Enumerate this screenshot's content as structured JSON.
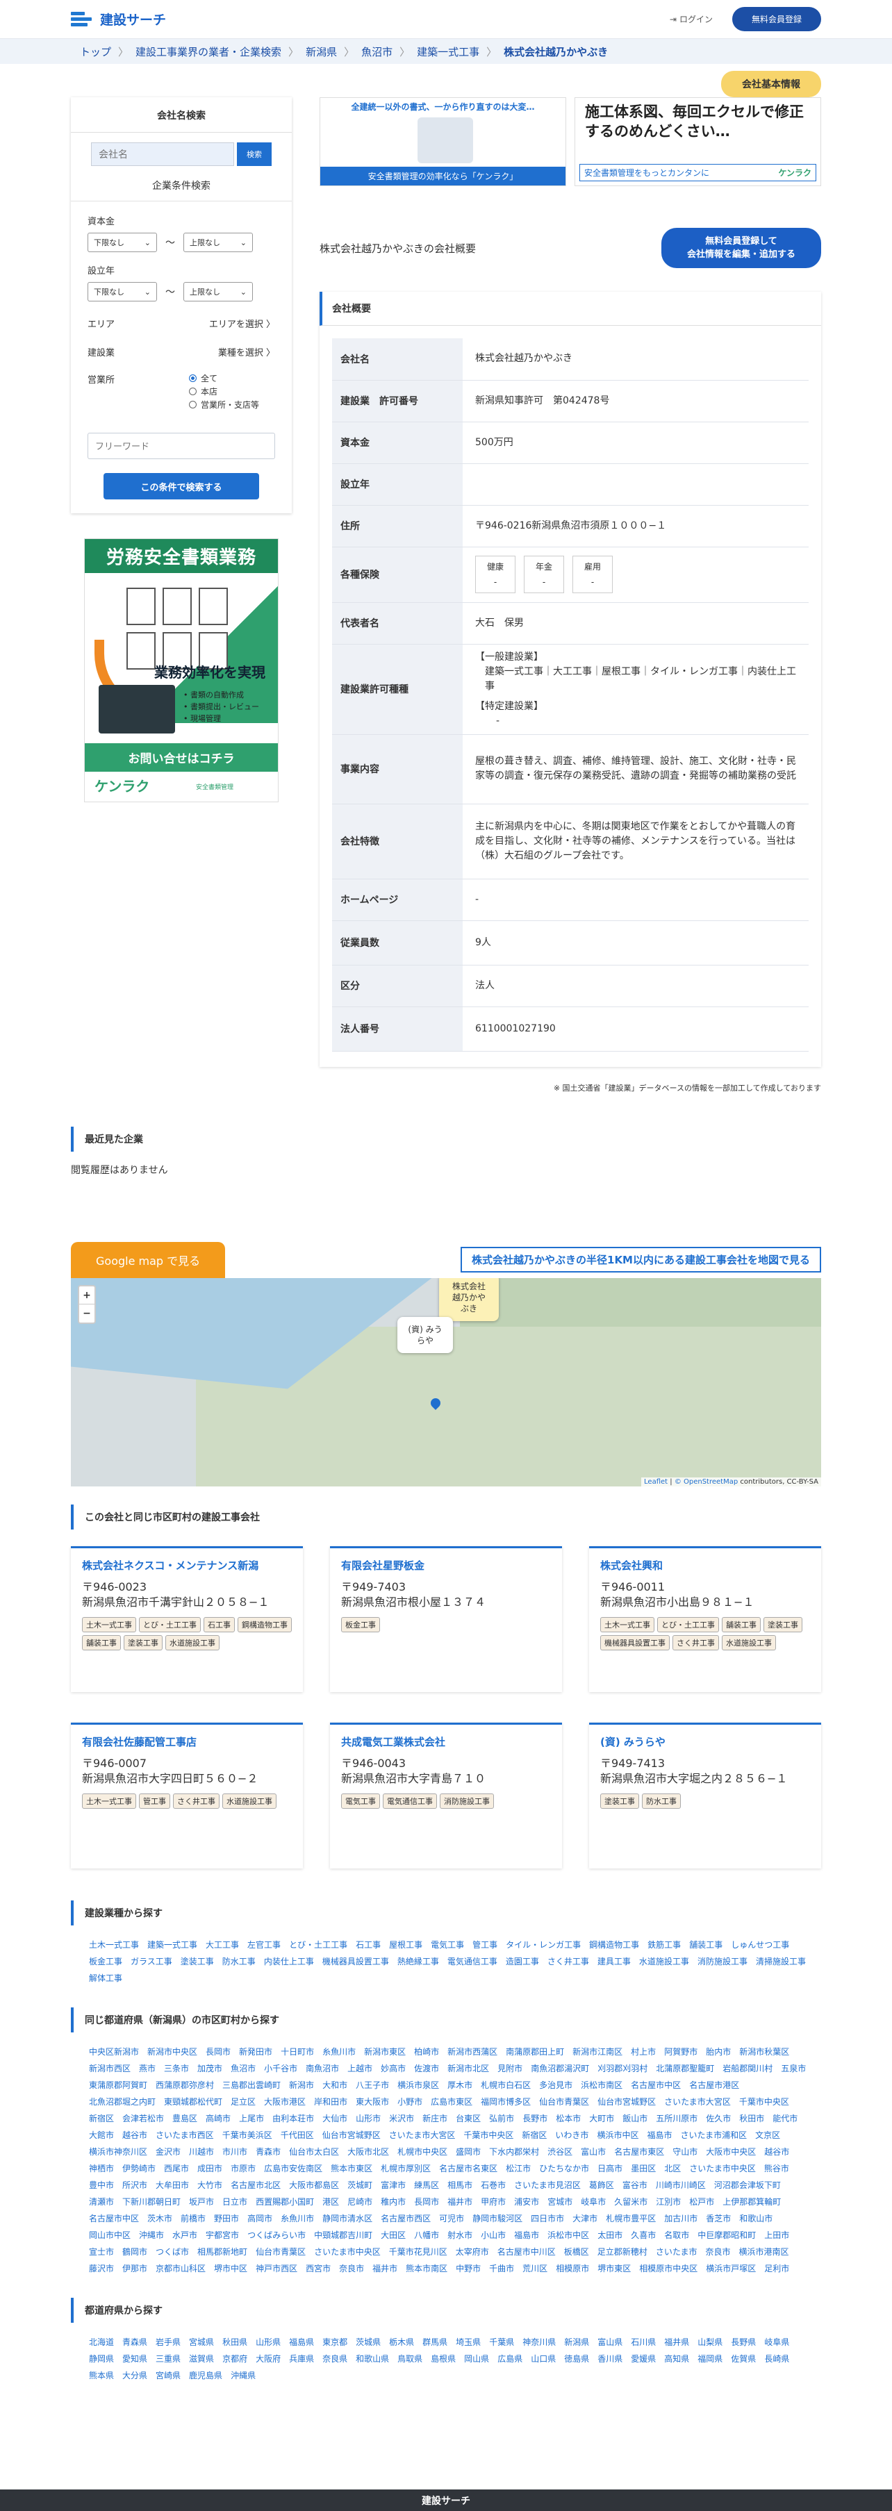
{
  "header": {
    "logo": "建設サーチ",
    "login": "ログイン",
    "register": "無料会員登録"
  },
  "breadcrumb": [
    "トップ",
    "建設工事業界の業者・企業検索",
    "新潟県",
    "魚沼市",
    "建築一式工事",
    "株式会社越乃かやぶき"
  ],
  "tag": "会社基本情報",
  "sidebar": {
    "title": "会社名検索",
    "search_placeholder": "会社名",
    "search_btn": "検索",
    "conditions": "企業条件検索",
    "capital": "資本金",
    "estab": "設立年",
    "lower": "下限なし",
    "upper": "上限なし",
    "tilde": "〜",
    "area": "エリア",
    "area_v": "エリアを選択",
    "industry": "建設業",
    "industry_v": "業種を選択",
    "office": "営業所",
    "office_opts": [
      "全て",
      "本店",
      "営業所・支店等"
    ],
    "free_placeholder": "フリーワード",
    "submit": "この条件で検索する"
  },
  "ad": {
    "title": "労務安全書類業務",
    "eff": "業務効率化を実現",
    "points": [
      "書類の自動作成",
      "書類提出・レビュー",
      "現場管理"
    ],
    "cta": "お問い合せはコチラ",
    "brand": "ケンラク",
    "small": "安全書類管理"
  },
  "banner1": {
    "text": "全建統一以外の書式、一から作り直すのは大変…",
    "caption": "安全書類管理の効率化なら「ケンラク」"
  },
  "banner2": {
    "text": "施工体系図、毎回エクセルで修正するのめんどくさい…",
    "caption": "安全書類管理をもっとカンタンに",
    "brand": "ケンラク"
  },
  "company_heading": "株式会社越乃かやぶきの会社概要",
  "free_btn": [
    "無料会員登録して",
    "会社情報を編集・追加する"
  ],
  "overview": "会社概要",
  "info": {
    "rows": [
      {
        "k": "会社名",
        "v": "株式会社越乃かやぶき"
      },
      {
        "k": "建設業　許可番号",
        "v": "新潟県知事許可　第042478号"
      },
      {
        "k": "資本金",
        "v": "500万円"
      },
      {
        "k": "設立年",
        "v": ""
      },
      {
        "k": "住所",
        "v": "〒946-0216新潟県魚沼市須原１０００−１"
      },
      {
        "k": "各種保険",
        "v": ""
      },
      {
        "k": "代表者名",
        "v": "大石　保男"
      },
      {
        "k": "建設業許可種種",
        "v": ""
      },
      {
        "k": "事業内容",
        "v": "屋根の葺き替え、調査、補修、維持管理、設計、施工、文化財・社寺・民家等の調査・復元保存の業務受託、遺跡の調査・発掘等の補助業務の受託"
      },
      {
        "k": "会社特徴",
        "v": "主に新潟県内を中心に、冬期は関東地区で作業をとおしてかや葺職人の育成を目指し、文化財・社寺等の補修、メンテナンスを行っている。当社は（株）大石組のグループ会社です。"
      },
      {
        "k": "ホームページ",
        "v": "-"
      },
      {
        "k": "従業員数",
        "v": "9人"
      },
      {
        "k": "区分",
        "v": "法人"
      },
      {
        "k": "法人番号",
        "v": "6110001027190"
      }
    ],
    "insurance": [
      {
        "n": "健康",
        "v": "-"
      },
      {
        "n": "年金",
        "v": "-"
      },
      {
        "n": "雇用",
        "v": "-"
      }
    ],
    "permit_general": "【一般建設業】",
    "permit_general_v": "建築一式工事｜大工工事｜屋根工事｜タイル・レンガ工事｜内装仕上工事",
    "permit_special": "【特定建設業】",
    "permit_special_v": "-"
  },
  "note": "※ 国土交通省「建設業」データベースの情報を一部加工して作成しております",
  "recent": {
    "title": "最近見た企業",
    "empty": "閲覧履歴はありません"
  },
  "map": {
    "gbtn": "Google map で見る",
    "radius": "株式会社越乃かやぶきの半径1KM以内にある建設工事会社を地図で見る",
    "pop1": "(資) みうらや",
    "pop2": "株式会社越乃かやぶき",
    "attr_a": "Leaflet",
    "attr_b": "© OpenStreetMap",
    "attr_c": "contributors, CC-BY-SA",
    "plus": "+",
    "minus": "−"
  },
  "same_city": "この会社と同じ市区町村の建設工事会社",
  "cards": [
    {
      "name": "株式会社ネクスコ・メンテナンス新潟",
      "zip": "〒946-0023",
      "addr": "新潟県魚沼市千溝宇針山２０５８−１",
      "tags": [
        "土木一式工事",
        "とび・土工工事",
        "石工事",
        "鋼構造物工事",
        "舗装工事",
        "塗装工事",
        "水道施設工事"
      ]
    },
    {
      "name": "有限会社星野板金",
      "zip": "〒949-7403",
      "addr": "新潟県魚沼市根小屋１３７４",
      "tags": [
        "板金工事"
      ]
    },
    {
      "name": "株式会社興和",
      "zip": "〒946-0011",
      "addr": "新潟県魚沼市小出島９８１−１",
      "tags": [
        "土木一式工事",
        "とび・土工工事",
        "舗装工事",
        "塗装工事",
        "機械器具設置工事",
        "さく井工事",
        "水道施設工事"
      ]
    },
    {
      "name": "有限会社佐藤配管工事店",
      "zip": "〒946-0007",
      "addr": "新潟県魚沼市大字四日町５６０−２",
      "tags": [
        "土木一式工事",
        "管工事",
        "さく井工事",
        "水道施設工事"
      ]
    },
    {
      "name": "共成電気工業株式会社",
      "zip": "〒946-0043",
      "addr": "新潟県魚沼市大字青島７１０",
      "tags": [
        "電気工事",
        "電気通信工事",
        "消防施設工事"
      ]
    },
    {
      "name": "(資) みうらや",
      "zip": "〒949-7413",
      "addr": "新潟県魚沼市大字堀之内２８５６−１",
      "tags": [
        "塗装工事",
        "防水工事"
      ]
    }
  ],
  "by_type": {
    "title": "建設業種から探す",
    "items": [
      "土木一式工事",
      "建築一式工事",
      "大工工事",
      "左官工事",
      "とび・土工工事",
      "石工事",
      "屋根工事",
      "電気工事",
      "管工事",
      "タイル・レンガ工事",
      "鋼構造物工事",
      "鉄筋工事",
      "舗装工事",
      "しゅんせつ工事",
      "板金工事",
      "ガラス工事",
      "塗装工事",
      "防水工事",
      "内装仕上工事",
      "機械器具設置工事",
      "熱絶縁工事",
      "電気通信工事",
      "造園工事",
      "さく井工事",
      "建具工事",
      "水道施設工事",
      "消防施設工事",
      "清掃施設工事",
      "解体工事"
    ]
  },
  "by_city": {
    "title": "同じ都道府県（新潟県）の市区町村から探す",
    "items": [
      "中央区新潟市",
      "新潟市中央区",
      "長岡市",
      "新発田市",
      "十日町市",
      "糸魚川市",
      "新潟市東区",
      "柏崎市",
      "新潟市西蒲区",
      "南蒲原郡田上町",
      "新潟市江南区",
      "村上市",
      "阿賀野市",
      "胎内市",
      "新潟市秋葉区",
      "新潟市西区",
      "燕市",
      "三条市",
      "加茂市",
      "魚沼市",
      "小千谷市",
      "南魚沼市",
      "上越市",
      "妙高市",
      "佐渡市",
      "新潟市北区",
      "見附市",
      "南魚沼郡湯沢町",
      "刈羽郡刈羽村",
      "北蒲原郡聖籠町",
      "岩船郡関川村",
      "五泉市",
      "東蒲原郡阿賀町",
      "西蒲原郡弥彦村",
      "三島郡出雲崎町",
      "新潟市",
      "大和市",
      "八王子市",
      "横浜市泉区",
      "厚木市",
      "札幌市白石区",
      "多治見市",
      "浜松市南区",
      "名古屋市中区",
      "名古屋市港区",
      "北魚沼郡堀之内町",
      "東頸城郡松代町",
      "足立区",
      "大阪市港区",
      "岸和田市",
      "東大阪市",
      "小野市",
      "広島市東区",
      "福岡市博多区",
      "仙台市青葉区",
      "仙台市宮城野区",
      "さいたま市大宮区",
      "千葉市中央区",
      "新宿区",
      "会津若松市",
      "豊島区",
      "高崎市",
      "上尾市",
      "由利本荘市",
      "大仙市",
      "山形市",
      "米沢市",
      "新庄市",
      "台東区",
      "弘前市",
      "長野市",
      "松本市",
      "大町市",
      "飯山市",
      "五所川原市",
      "佐久市",
      "秋田市",
      "能代市",
      "大館市",
      "越谷市",
      "さいたま市西区",
      "千葉市美浜区",
      "千代田区",
      "仙台市宮城野区",
      "さいたま市大宮区",
      "千葉市中央区",
      "新宿区",
      "いわき市",
      "横浜市中区",
      "福島市",
      "さいたま市浦和区",
      "文京区",
      "横浜市神奈川区",
      "金沢市",
      "川越市",
      "市川市",
      "青森市",
      "仙台市太白区",
      "大阪市北区",
      "札幌市中央区",
      "盛岡市",
      "下水内郡栄村",
      "渋谷区",
      "富山市",
      "名古屋市東区",
      "守山市",
      "大阪市中央区",
      "越谷市",
      "神栖市",
      "伊勢崎市",
      "西尾市",
      "成田市",
      "市原市",
      "広島市安佐南区",
      "熊本市東区",
      "札幌市厚別区",
      "名古屋市名東区",
      "松江市",
      "ひたちなか市",
      "日高市",
      "墨田区",
      "北区",
      "さいたま市中央区",
      "熊谷市",
      "豊中市",
      "所沢市",
      "大牟田市",
      "大竹市",
      "名古屋市北区",
      "大阪市都島区",
      "茨城町",
      "富津市",
      "練馬区",
      "相馬市",
      "石巻市",
      "さいたま市見沼区",
      "葛飾区",
      "富谷市",
      "川崎市川崎区",
      "河沼郡会津坂下町",
      "清瀬市",
      "下新川郡朝日町",
      "坂戸市",
      "日立市",
      "西置賜郡小国町",
      "港区",
      "尼崎市",
      "稚内市",
      "長岡市",
      "福井市",
      "甲府市",
      "浦安市",
      "宮城市",
      "岐阜市",
      "久留米市",
      "江別市",
      "松戸市",
      "上伊那郡箕輪町",
      "名古屋市中区",
      "茨木市",
      "前橋市",
      "野田市",
      "高岡市",
      "糸魚川市",
      "静岡市清水区",
      "名古屋市西区",
      "可児市",
      "静岡市駿河区",
      "四日市市",
      "大津市",
      "札幌市豊平区",
      "加古川市",
      "香芝市",
      "和歌山市",
      "岡山市中区",
      "沖縄市",
      "水戸市",
      "宇都宮市",
      "つくばみらい市",
      "中頸城郡吉川町",
      "大田区",
      "八幡市",
      "射水市",
      "小山市",
      "福島市",
      "浜松市中区",
      "太田市",
      "久喜市",
      "名取市",
      "中巨摩郡昭和町",
      "上田市",
      "宣士市",
      "鶴岡市",
      "つくば市",
      "相馬郡新地町",
      "仙台市青葉区",
      "さいたま市中央区",
      "千葉市花見川区",
      "太宰府市",
      "名古屋市中川区",
      "板橋区",
      "足立郡新穂村",
      "さいたま市",
      "奈良市",
      "横浜市港南区",
      "藤沢市",
      "伊那市",
      "京都市山科区",
      "堺市中区",
      "神戸市西区",
      "西宮市",
      "奈良市",
      "福井市",
      "熊本市南区",
      "中野市",
      "千曲市",
      "荒川区",
      "相模原市",
      "堺市東区",
      "相模原市中央区",
      "横浜市戸塚区",
      "足利市"
    ]
  },
  "by_pref": {
    "title": "都道府県から探す",
    "items": [
      "北海道",
      "青森県",
      "岩手県",
      "宮城県",
      "秋田県",
      "山形県",
      "福島県",
      "東京都",
      "茨城県",
      "栃木県",
      "群馬県",
      "埼玉県",
      "千葉県",
      "神奈川県",
      "新潟県",
      "富山県",
      "石川県",
      "福井県",
      "山梨県",
      "長野県",
      "岐阜県",
      "静岡県",
      "愛知県",
      "三重県",
      "滋賀県",
      "京都府",
      "大阪府",
      "兵庫県",
      "奈良県",
      "和歌山県",
      "鳥取県",
      "島根県",
      "岡山県",
      "広島県",
      "山口県",
      "徳島県",
      "香川県",
      "愛媛県",
      "高知県",
      "福岡県",
      "佐賀県",
      "長崎県",
      "熊本県",
      "大分県",
      "宮崎県",
      "鹿児島県",
      "沖縄県"
    ]
  },
  "footer": "建設サーチ"
}
